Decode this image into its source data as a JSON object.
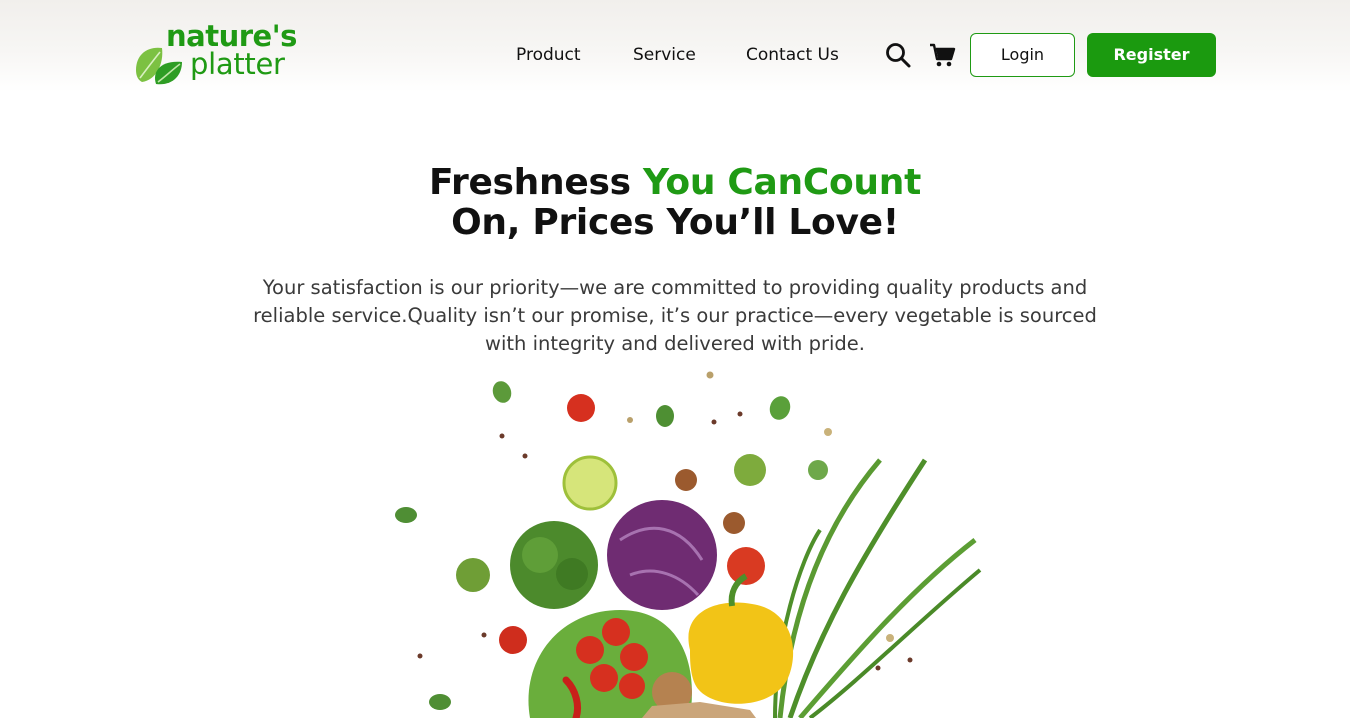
{
  "brand": {
    "line1": "nature's",
    "line2": "platter",
    "color": "#1f9a14"
  },
  "nav": {
    "links": [
      "Product",
      "Service",
      "Contact Us"
    ],
    "search_icon": "search-icon",
    "cart_icon": "cart-icon",
    "login_label": "Login",
    "register_label": "Register"
  },
  "hero": {
    "title_part1": "Freshness ",
    "title_accent": "You CanCount",
    "title_line2": "On, Prices You’ll Love!",
    "subtitle": "Your satisfaction is our priority—we are committed to providing quality products and reliable service.Quality isn’t our promise, it’s our practice—every vegetable is sourced with integrity and delivered with pride."
  },
  "colors": {
    "accent": "#1f9a14",
    "button": "#1b9a0f",
    "text": "#111111"
  }
}
